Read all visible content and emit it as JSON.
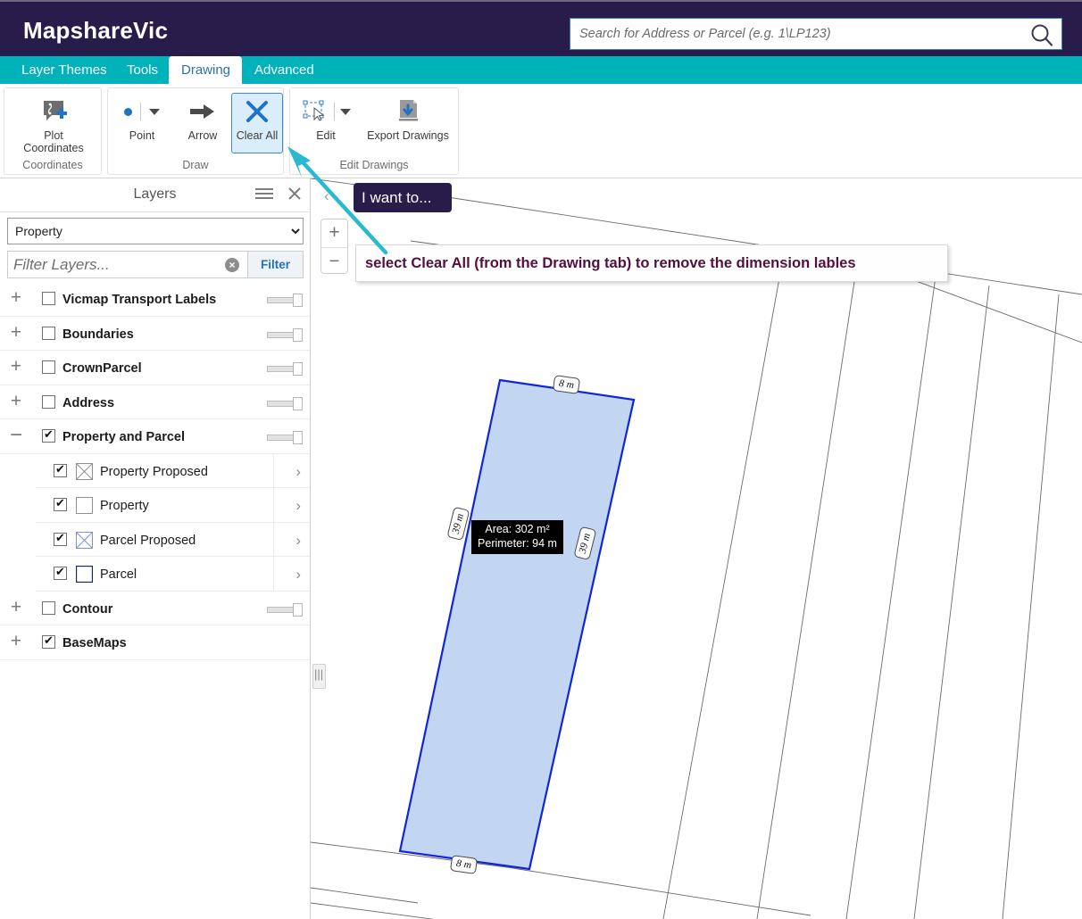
{
  "header": {
    "brand": "MapshareVic",
    "search_placeholder": "Search for Address or Parcel (e.g. 1\\LP123)",
    "search_value": "",
    "search_icon": "search-icon",
    "colors": {
      "navy": "#271c4a",
      "teal": "#00b2ba",
      "accent_blue": "#2f6fae"
    }
  },
  "tabs": [
    {
      "label": "Layer Themes",
      "active": false
    },
    {
      "label": "Tools",
      "active": false
    },
    {
      "label": "Drawing",
      "active": true
    },
    {
      "label": "Advanced",
      "active": false
    }
  ],
  "ribbon": {
    "groups": [
      {
        "name": "Coordinates",
        "label": "Coordinates",
        "buttons": [
          {
            "label": "Plot Coordinates",
            "icon": "plot-coordinates-icon",
            "selected": false,
            "has_dropdown": false
          }
        ]
      },
      {
        "name": "Draw",
        "label": "Draw",
        "buttons": [
          {
            "label": "Point",
            "icon": "point-icon",
            "selected": false,
            "has_dropdown": true
          },
          {
            "label": "Arrow",
            "icon": "arrow-icon",
            "selected": false,
            "has_dropdown": false
          },
          {
            "label": "Clear All",
            "icon": "clear-all-x-icon",
            "selected": true,
            "has_dropdown": false
          }
        ]
      },
      {
        "name": "Edit Drawings",
        "label": "Edit Drawings",
        "buttons": [
          {
            "label": "Edit",
            "icon": "edit-selection-icon",
            "selected": false,
            "has_dropdown": true
          },
          {
            "label": "Export Drawings",
            "icon": "export-drawings-icon",
            "selected": false,
            "has_dropdown": false
          }
        ]
      }
    ]
  },
  "panel": {
    "title": "Layers",
    "menu_icon": "hamburger-icon",
    "close_icon": "close-icon",
    "theme_select": {
      "value": "Property",
      "options": [
        "Property"
      ]
    },
    "filter": {
      "placeholder": "Filter Layers...",
      "value": "",
      "clear_icon": "clear-circle-icon",
      "button_label": "Filter"
    },
    "layers": [
      {
        "label": "Vicmap Transport Labels",
        "checked": false,
        "expander": "+",
        "bold": true,
        "indent": false,
        "opacity": true
      },
      {
        "label": "Boundaries",
        "checked": false,
        "expander": "+",
        "bold": true,
        "indent": false,
        "opacity": true
      },
      {
        "label": "CrownParcel",
        "checked": false,
        "expander": "+",
        "bold": true,
        "indent": false,
        "opacity": true
      },
      {
        "label": "Address",
        "checked": false,
        "expander": "+",
        "bold": true,
        "indent": false,
        "opacity": true
      },
      {
        "label": "Property and Parcel",
        "checked": true,
        "expander": "−",
        "bold": true,
        "indent": false,
        "opacity": true
      },
      {
        "label": "Property Proposed",
        "checked": true,
        "expander": "",
        "bold": false,
        "indent": true,
        "swatch": "hatched-grey",
        "chevron": "›"
      },
      {
        "label": "Property",
        "checked": true,
        "expander": "",
        "bold": false,
        "indent": true,
        "swatch": "plain-grey",
        "chevron": "›"
      },
      {
        "label": "Parcel Proposed",
        "checked": true,
        "expander": "",
        "bold": false,
        "indent": true,
        "swatch": "hatched-blue",
        "chevron": "›"
      },
      {
        "label": "Parcel",
        "checked": true,
        "expander": "",
        "bold": false,
        "indent": true,
        "swatch": "plain-navy",
        "chevron": "›"
      },
      {
        "label": "Contour",
        "checked": false,
        "expander": "+",
        "bold": true,
        "indent": false,
        "opacity": true
      },
      {
        "label": "BaseMaps",
        "checked": true,
        "expander": "+",
        "bold": true,
        "indent": false,
        "opacity": false
      }
    ]
  },
  "map": {
    "zoom_in_label": "+",
    "zoom_out_label": "−",
    "collapse_icon": "chevron-left-icon",
    "splitter_icon": "panel-splitter-handle",
    "callout_iwant": "I want to...",
    "callout_note": "select Clear All (from the Drawing tab) to remove the dimension lables",
    "annotation_arrow_color": "#2ab9cf",
    "parcel_fill": "#bed3f0",
    "parcel_stroke": "#1126d8",
    "dimension_labels": [
      {
        "text": "8 m",
        "position": "top"
      },
      {
        "text": "39 m",
        "position": "left"
      },
      {
        "text": "39 m",
        "position": "right"
      },
      {
        "text": "8 m",
        "position": "bottom"
      }
    ],
    "measurement": {
      "area": "Area: 302 m²",
      "perimeter": "Perimeter: 94 m"
    }
  }
}
